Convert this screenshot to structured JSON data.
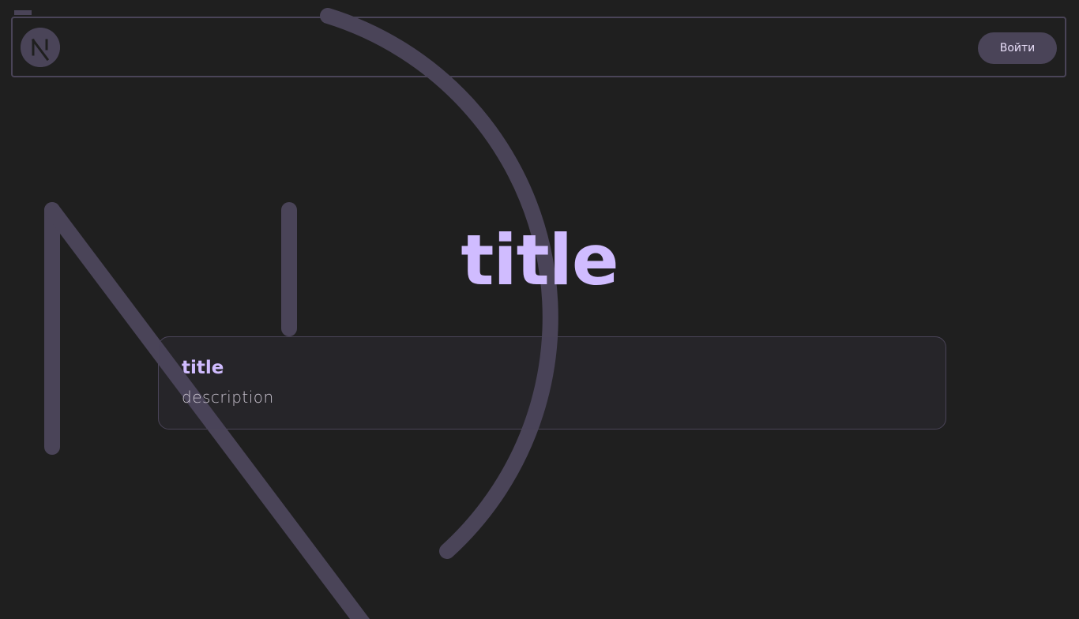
{
  "header": {
    "logo_icon": "nextjs-logo-icon",
    "login_label": "Войти"
  },
  "hero": {
    "title": "title"
  },
  "card": {
    "title": "title",
    "description": "description"
  },
  "background": {
    "icon": "nextjs-logo-icon"
  },
  "colors": {
    "background": "#1f1f1f",
    "accent": "#d0bcff",
    "surface": "#4a4458",
    "muted_text": "#cac4d0"
  }
}
